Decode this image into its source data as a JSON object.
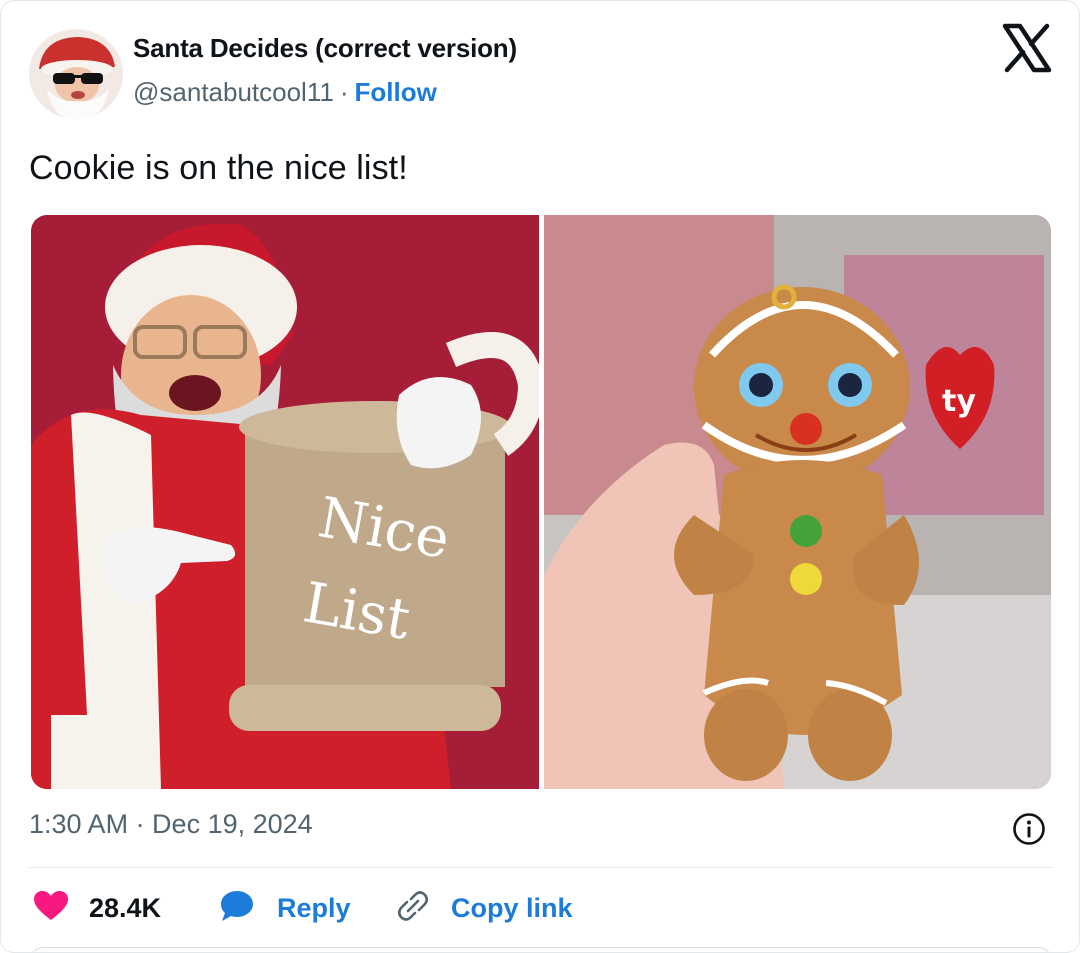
{
  "author": {
    "name": "Santa Decides (correct version)",
    "handle": "@santabutcool11",
    "separator": "·",
    "follow_label": "Follow"
  },
  "tweet": {
    "text": "Cookie is on the nice list!",
    "timestamp": "1:30 AM · Dec 19, 2024"
  },
  "media": {
    "left_scroll_text_line1": "Nice",
    "left_scroll_text_line2": "List",
    "right_tag_text": "ty"
  },
  "actions": {
    "like_count": "28.4K",
    "reply_label": "Reply",
    "copy_link_label": "Copy link"
  },
  "colors": {
    "link": "#1d7bd9",
    "like": "#f91880",
    "secondary_text": "#536471"
  },
  "icons": [
    "x-logo-icon",
    "info-icon",
    "heart-icon",
    "reply-bubble-icon",
    "link-icon"
  ]
}
